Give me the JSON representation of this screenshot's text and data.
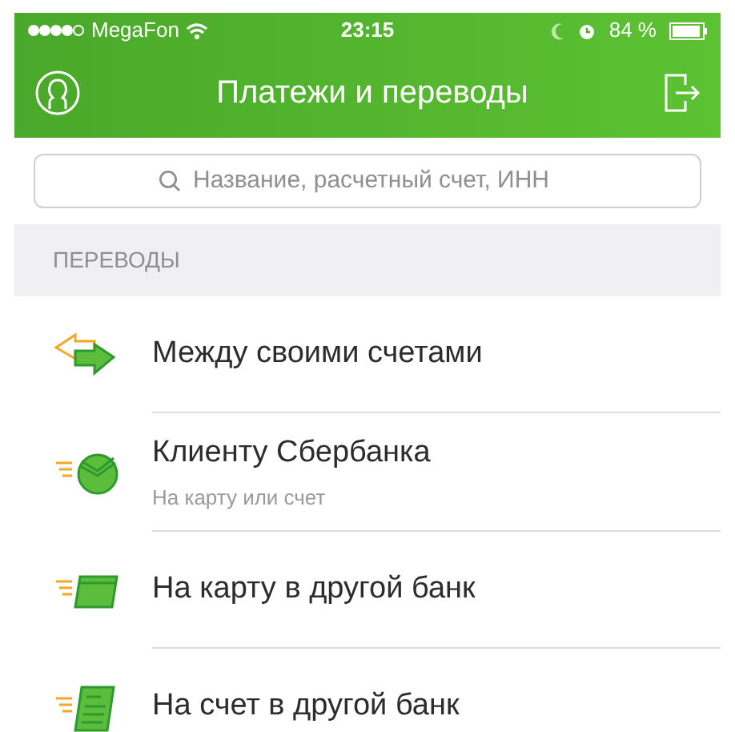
{
  "status_bar": {
    "carrier": "MegaFon",
    "time": "23:15",
    "battery": "84 %"
  },
  "nav": {
    "title": "Платежи и переводы"
  },
  "search": {
    "placeholder": "Название, расчетный счет, ИНН"
  },
  "section": {
    "title": "ПЕРЕВОДЫ"
  },
  "items": [
    {
      "kind": "transfer",
      "title": "Между своими счетами"
    },
    {
      "kind": "client",
      "title": "Клиенту Сбербанка",
      "subtitle": "На карту или счет"
    },
    {
      "kind": "card",
      "title": "На карту в другой банк"
    },
    {
      "kind": "account",
      "title": "На счет в другой банк"
    }
  ]
}
